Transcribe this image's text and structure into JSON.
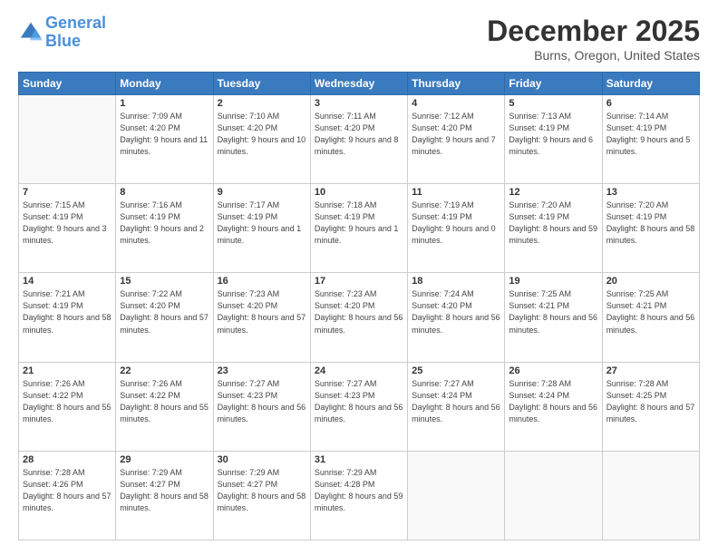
{
  "logo": {
    "line1": "General",
    "line2": "Blue"
  },
  "title": "December 2025",
  "location": "Burns, Oregon, United States",
  "weekdays": [
    "Sunday",
    "Monday",
    "Tuesday",
    "Wednesday",
    "Thursday",
    "Friday",
    "Saturday"
  ],
  "weeks": [
    [
      {
        "num": "",
        "sunrise": "",
        "sunset": "",
        "daylight": ""
      },
      {
        "num": "1",
        "sunrise": "Sunrise: 7:09 AM",
        "sunset": "Sunset: 4:20 PM",
        "daylight": "Daylight: 9 hours and 11 minutes."
      },
      {
        "num": "2",
        "sunrise": "Sunrise: 7:10 AM",
        "sunset": "Sunset: 4:20 PM",
        "daylight": "Daylight: 9 hours and 10 minutes."
      },
      {
        "num": "3",
        "sunrise": "Sunrise: 7:11 AM",
        "sunset": "Sunset: 4:20 PM",
        "daylight": "Daylight: 9 hours and 8 minutes."
      },
      {
        "num": "4",
        "sunrise": "Sunrise: 7:12 AM",
        "sunset": "Sunset: 4:20 PM",
        "daylight": "Daylight: 9 hours and 7 minutes."
      },
      {
        "num": "5",
        "sunrise": "Sunrise: 7:13 AM",
        "sunset": "Sunset: 4:19 PM",
        "daylight": "Daylight: 9 hours and 6 minutes."
      },
      {
        "num": "6",
        "sunrise": "Sunrise: 7:14 AM",
        "sunset": "Sunset: 4:19 PM",
        "daylight": "Daylight: 9 hours and 5 minutes."
      }
    ],
    [
      {
        "num": "7",
        "sunrise": "Sunrise: 7:15 AM",
        "sunset": "Sunset: 4:19 PM",
        "daylight": "Daylight: 9 hours and 3 minutes."
      },
      {
        "num": "8",
        "sunrise": "Sunrise: 7:16 AM",
        "sunset": "Sunset: 4:19 PM",
        "daylight": "Daylight: 9 hours and 2 minutes."
      },
      {
        "num": "9",
        "sunrise": "Sunrise: 7:17 AM",
        "sunset": "Sunset: 4:19 PM",
        "daylight": "Daylight: 9 hours and 1 minute."
      },
      {
        "num": "10",
        "sunrise": "Sunrise: 7:18 AM",
        "sunset": "Sunset: 4:19 PM",
        "daylight": "Daylight: 9 hours and 1 minute."
      },
      {
        "num": "11",
        "sunrise": "Sunrise: 7:19 AM",
        "sunset": "Sunset: 4:19 PM",
        "daylight": "Daylight: 9 hours and 0 minutes."
      },
      {
        "num": "12",
        "sunrise": "Sunrise: 7:20 AM",
        "sunset": "Sunset: 4:19 PM",
        "daylight": "Daylight: 8 hours and 59 minutes."
      },
      {
        "num": "13",
        "sunrise": "Sunrise: 7:20 AM",
        "sunset": "Sunset: 4:19 PM",
        "daylight": "Daylight: 8 hours and 58 minutes."
      }
    ],
    [
      {
        "num": "14",
        "sunrise": "Sunrise: 7:21 AM",
        "sunset": "Sunset: 4:19 PM",
        "daylight": "Daylight: 8 hours and 58 minutes."
      },
      {
        "num": "15",
        "sunrise": "Sunrise: 7:22 AM",
        "sunset": "Sunset: 4:20 PM",
        "daylight": "Daylight: 8 hours and 57 minutes."
      },
      {
        "num": "16",
        "sunrise": "Sunrise: 7:23 AM",
        "sunset": "Sunset: 4:20 PM",
        "daylight": "Daylight: 8 hours and 57 minutes."
      },
      {
        "num": "17",
        "sunrise": "Sunrise: 7:23 AM",
        "sunset": "Sunset: 4:20 PM",
        "daylight": "Daylight: 8 hours and 56 minutes."
      },
      {
        "num": "18",
        "sunrise": "Sunrise: 7:24 AM",
        "sunset": "Sunset: 4:20 PM",
        "daylight": "Daylight: 8 hours and 56 minutes."
      },
      {
        "num": "19",
        "sunrise": "Sunrise: 7:25 AM",
        "sunset": "Sunset: 4:21 PM",
        "daylight": "Daylight: 8 hours and 56 minutes."
      },
      {
        "num": "20",
        "sunrise": "Sunrise: 7:25 AM",
        "sunset": "Sunset: 4:21 PM",
        "daylight": "Daylight: 8 hours and 56 minutes."
      }
    ],
    [
      {
        "num": "21",
        "sunrise": "Sunrise: 7:26 AM",
        "sunset": "Sunset: 4:22 PM",
        "daylight": "Daylight: 8 hours and 55 minutes."
      },
      {
        "num": "22",
        "sunrise": "Sunrise: 7:26 AM",
        "sunset": "Sunset: 4:22 PM",
        "daylight": "Daylight: 8 hours and 55 minutes."
      },
      {
        "num": "23",
        "sunrise": "Sunrise: 7:27 AM",
        "sunset": "Sunset: 4:23 PM",
        "daylight": "Daylight: 8 hours and 56 minutes."
      },
      {
        "num": "24",
        "sunrise": "Sunrise: 7:27 AM",
        "sunset": "Sunset: 4:23 PM",
        "daylight": "Daylight: 8 hours and 56 minutes."
      },
      {
        "num": "25",
        "sunrise": "Sunrise: 7:27 AM",
        "sunset": "Sunset: 4:24 PM",
        "daylight": "Daylight: 8 hours and 56 minutes."
      },
      {
        "num": "26",
        "sunrise": "Sunrise: 7:28 AM",
        "sunset": "Sunset: 4:24 PM",
        "daylight": "Daylight: 8 hours and 56 minutes."
      },
      {
        "num": "27",
        "sunrise": "Sunrise: 7:28 AM",
        "sunset": "Sunset: 4:25 PM",
        "daylight": "Daylight: 8 hours and 57 minutes."
      }
    ],
    [
      {
        "num": "28",
        "sunrise": "Sunrise: 7:28 AM",
        "sunset": "Sunset: 4:26 PM",
        "daylight": "Daylight: 8 hours and 57 minutes."
      },
      {
        "num": "29",
        "sunrise": "Sunrise: 7:29 AM",
        "sunset": "Sunset: 4:27 PM",
        "daylight": "Daylight: 8 hours and 58 minutes."
      },
      {
        "num": "30",
        "sunrise": "Sunrise: 7:29 AM",
        "sunset": "Sunset: 4:27 PM",
        "daylight": "Daylight: 8 hours and 58 minutes."
      },
      {
        "num": "31",
        "sunrise": "Sunrise: 7:29 AM",
        "sunset": "Sunset: 4:28 PM",
        "daylight": "Daylight: 8 hours and 59 minutes."
      },
      {
        "num": "",
        "sunrise": "",
        "sunset": "",
        "daylight": ""
      },
      {
        "num": "",
        "sunrise": "",
        "sunset": "",
        "daylight": ""
      },
      {
        "num": "",
        "sunrise": "",
        "sunset": "",
        "daylight": ""
      }
    ]
  ]
}
